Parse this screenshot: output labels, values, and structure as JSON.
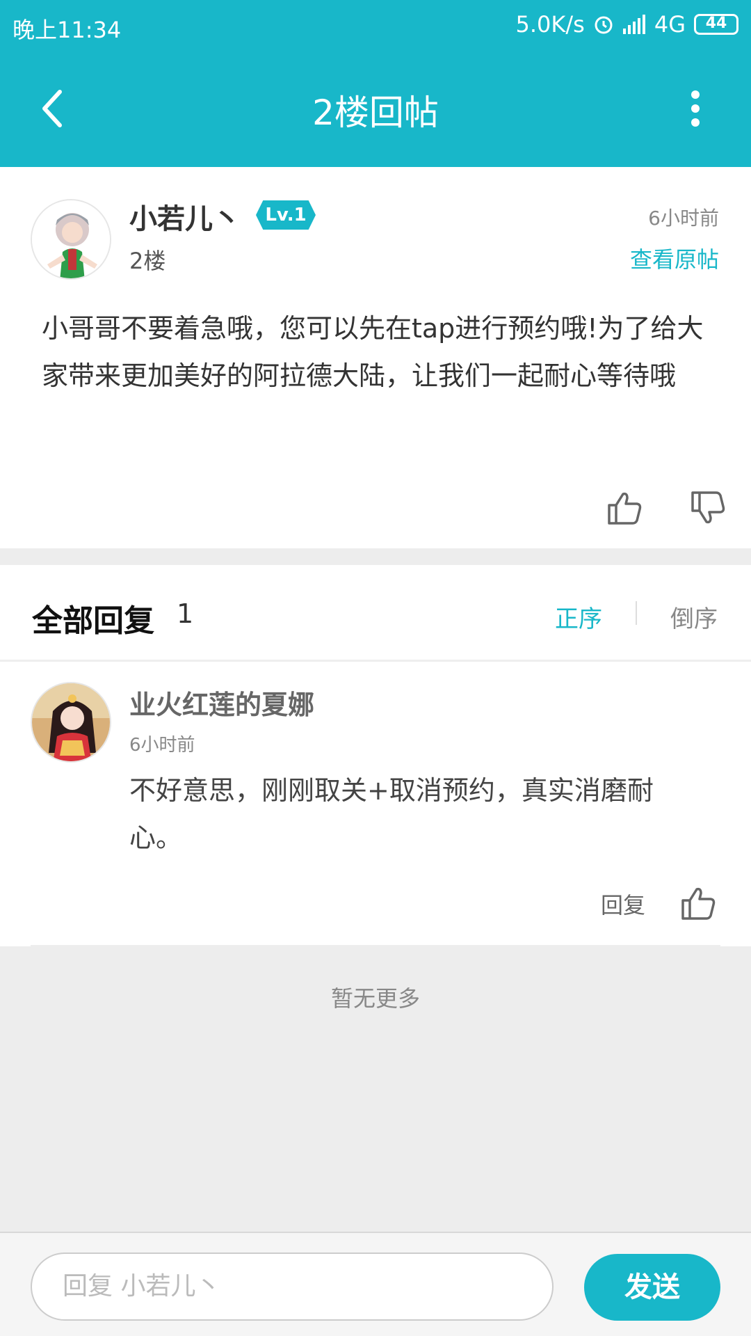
{
  "status_bar": {
    "time": "晚上11:34",
    "speed": "5.0K/s",
    "network": "4G",
    "battery": "44"
  },
  "header": {
    "title": "2楼回帖",
    "back_icon": "chevron-left-icon",
    "more_icon": "more-vertical-icon"
  },
  "post": {
    "author": "小若儿丶",
    "level": "Lv.1",
    "floor": "2楼",
    "time": "6小时前",
    "view_original": "查看原帖",
    "content": "小哥哥不要着急哦，您可以先在tap进行预约哦!为了给大家带来更加美好的阿拉德大陆，让我们一起耐心等待哦"
  },
  "replies": {
    "title": "全部回复",
    "count": "1",
    "sort_asc": "正序",
    "sort_desc": "倒序",
    "items": [
      {
        "name": "业火红莲的夏娜",
        "time": "6小时前",
        "text": "不好意思，刚刚取关+取消预约，真实消磨耐心。",
        "reply_label": "回复"
      }
    ]
  },
  "no_more": "暂无更多",
  "compose": {
    "placeholder": "回复 小若儿丶",
    "send_label": "发送"
  },
  "colors": {
    "accent": "#18b7c9",
    "background": "#ededed"
  }
}
